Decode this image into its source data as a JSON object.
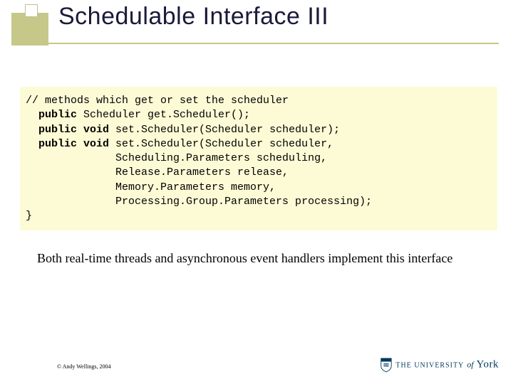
{
  "title": "Schedulable Interface III",
  "code": {
    "comment": "// methods which get or set the scheduler",
    "l1a": "  public",
    "l1b": " Scheduler get.Scheduler();",
    "l2a": "  public",
    "l2b": " void",
    "l2c": " set.Scheduler(Scheduler scheduler);",
    "l3a": "  public",
    "l3b": " void",
    "l3c": " set.Scheduler(Scheduler scheduler,",
    "l4": "              Scheduling.Parameters scheduling,",
    "l5": "              Release.Parameters release,",
    "l6": "              Memory.Parameters memory,",
    "l7": "              Processing.Group.Parameters processing);",
    "close": "}"
  },
  "body": "Both real-time threads and asynchronous event handlers implement this interface",
  "copyright": "© Andy Wellings, 2004",
  "logo": {
    "line1": "THE UNIVERSITY",
    "of": "of",
    "york": "York"
  }
}
